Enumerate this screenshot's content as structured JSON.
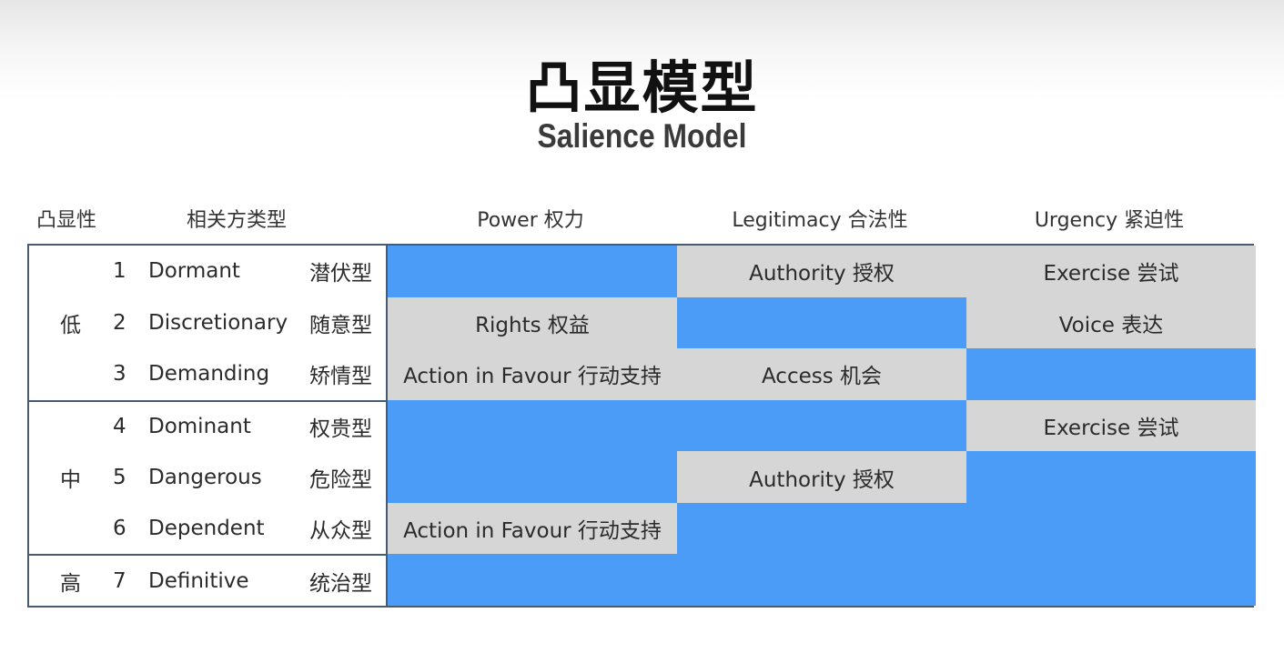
{
  "title_cn": "凸显模型",
  "title_en": "Salience Model",
  "headers": {
    "salience": "凸显性",
    "type": "相关方类型",
    "power": "Power 权力",
    "legitimacy": "Legitimacy 合法性",
    "urgency": "Urgency 紧迫性"
  },
  "levels": {
    "low": "低",
    "mid": "中",
    "high": "高"
  },
  "rows": [
    {
      "num": "1",
      "name": "Dormant",
      "type": "潜伏型",
      "power": "",
      "legitimacy": "Authority 授权",
      "urgency": "Exercise 尝试"
    },
    {
      "num": "2",
      "name": "Discretionary",
      "type": "随意型",
      "power": "Rights 权益",
      "legitimacy": "",
      "urgency": "Voice 表达"
    },
    {
      "num": "3",
      "name": "Demanding",
      "type": "矫情型",
      "power": "Action in Favour 行动支持",
      "legitimacy": "Access 机会",
      "urgency": ""
    },
    {
      "num": "4",
      "name": "Dominant",
      "type": "权贵型",
      "power": "",
      "legitimacy": "",
      "urgency": "Exercise 尝试"
    },
    {
      "num": "5",
      "name": "Dangerous",
      "type": "危险型",
      "power": "",
      "legitimacy": "Authority 授权",
      "urgency": ""
    },
    {
      "num": "6",
      "name": "Dependent",
      "type": "从众型",
      "power": "Action in Favour 行动支持",
      "legitimacy": "",
      "urgency": ""
    },
    {
      "num": "7",
      "name": "Definitive",
      "type": "统治型",
      "power": "",
      "legitimacy": "",
      "urgency": ""
    }
  ],
  "colors": {
    "blue": "#4a9cf6",
    "grey": "#d6d6d6",
    "border": "#4a5a70"
  }
}
